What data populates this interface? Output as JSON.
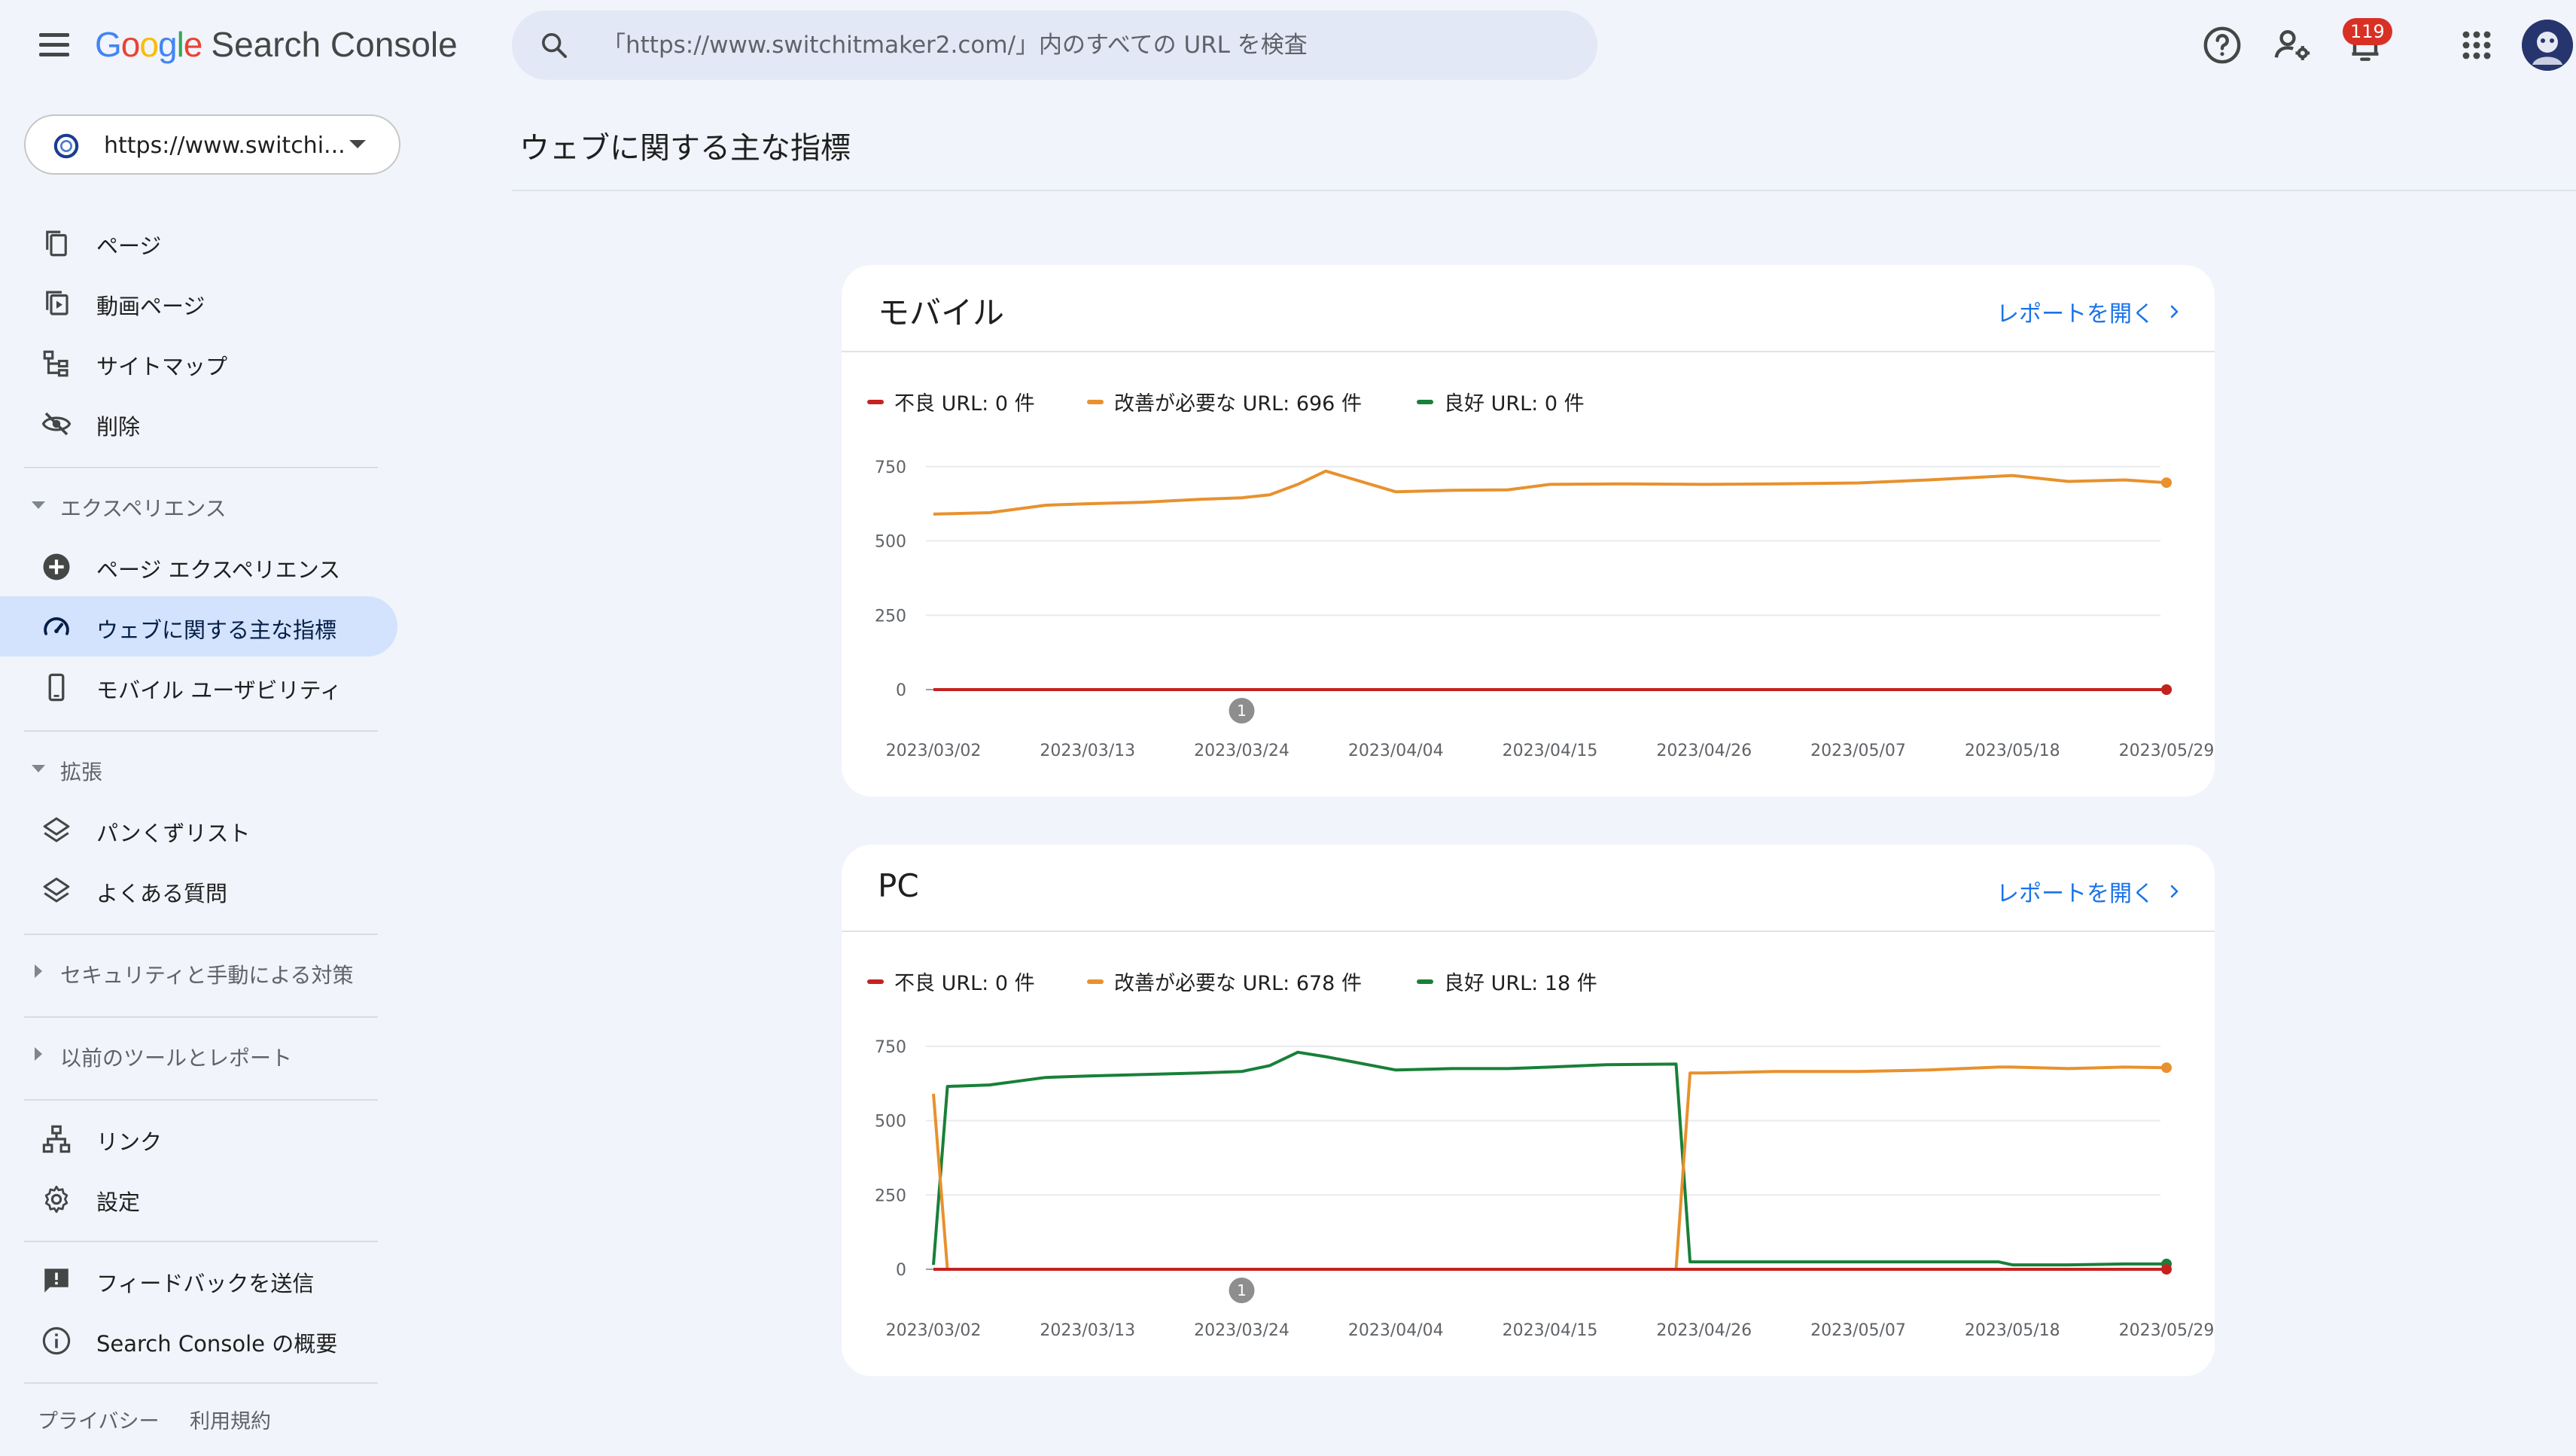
{
  "header": {
    "logo_google": "Google",
    "logo_product": "Search Console",
    "search_placeholder": "「https://www.switchitmaker2.com/」内のすべての URL を検査",
    "notifications_count": "119"
  },
  "sidebar": {
    "property_label": "https://www.switchi...",
    "items_top": [
      {
        "label": "ページ",
        "icon": "pages-icon"
      },
      {
        "label": "動画ページ",
        "icon": "video-pages-icon"
      },
      {
        "label": "サイトマップ",
        "icon": "sitemap-icon"
      },
      {
        "label": "削除",
        "icon": "removals-icon"
      }
    ],
    "section_experience": "エクスペリエンス",
    "items_experience": [
      {
        "label": "ページ エクスペリエンス",
        "icon": "page-experience-icon"
      },
      {
        "label": "ウェブに関する主な指標",
        "icon": "core-web-vitals-icon"
      },
      {
        "label": "モバイル ユーザビリティ",
        "icon": "mobile-icon"
      }
    ],
    "section_enhancements": "拡張",
    "items_enhancements": [
      {
        "label": "パンくずリスト",
        "icon": "layers-icon"
      },
      {
        "label": "よくある質問",
        "icon": "layers-icon"
      }
    ],
    "section_security": "セキュリティと手動による対策",
    "section_legacy": "以前のツールとレポート",
    "items_bottom": [
      {
        "label": "リンク",
        "icon": "links-icon"
      },
      {
        "label": "設定",
        "icon": "settings-icon"
      }
    ],
    "items_footer": [
      {
        "label": "フィードバックを送信",
        "icon": "feedback-icon"
      },
      {
        "label": "Search Console の概要",
        "icon": "info-icon"
      }
    ],
    "footer_links": [
      "プライバシー",
      "利用規約"
    ]
  },
  "main": {
    "page_title": "ウェブに関する主な指標",
    "open_report_label": "レポートを開く"
  },
  "colors": {
    "poor": "#c5221f",
    "needs_improvement": "#e8912d",
    "good": "#188038",
    "annotation": "#8e8e8e"
  },
  "chart_data": [
    {
      "type": "line",
      "title": "モバイル",
      "x": [
        "2023/03/02",
        "2023/03/06",
        "2023/03/10",
        "2023/03/13",
        "2023/03/17",
        "2023/03/21",
        "2023/03/24",
        "2023/03/26",
        "2023/03/28",
        "2023/03/30",
        "2023/04/04",
        "2023/04/08",
        "2023/04/12",
        "2023/04/15",
        "2023/04/20",
        "2023/04/26",
        "2023/05/01",
        "2023/05/07",
        "2023/05/12",
        "2023/05/18",
        "2023/05/22",
        "2023/05/26",
        "2023/05/29"
      ],
      "xticks": [
        "2023/03/02",
        "2023/03/13",
        "2023/03/24",
        "2023/04/04",
        "2023/04/15",
        "2023/04/26",
        "2023/05/07",
        "2023/05/18",
        "2023/05/29"
      ],
      "yticks": [
        0,
        250,
        500,
        750
      ],
      "ylim": [
        0,
        800
      ],
      "series": [
        {
          "name": "不良 URL",
          "legend": "不良 URL: 0 件",
          "color": "#c5221f",
          "values": [
            0,
            0,
            0,
            0,
            0,
            0,
            0,
            0,
            0,
            0,
            0,
            0,
            0,
            0,
            0,
            0,
            0,
            0,
            0,
            0,
            0,
            0,
            0
          ]
        },
        {
          "name": "改善が必要な URL",
          "legend": "改善が必要な URL: 696 件",
          "color": "#e8912d",
          "values": [
            590,
            595,
            620,
            625,
            630,
            640,
            645,
            655,
            690,
            735,
            665,
            670,
            672,
            690,
            692,
            690,
            692,
            695,
            705,
            720,
            700,
            705,
            696
          ]
        },
        {
          "name": "良好 URL",
          "legend": "良好 URL: 0 件",
          "color": "#188038",
          "values": [
            0,
            0,
            0,
            0,
            0,
            0,
            0,
            0,
            0,
            0,
            0,
            0,
            0,
            0,
            0,
            0,
            0,
            0,
            0,
            0,
            0,
            0,
            0
          ]
        }
      ],
      "annotation": {
        "x": "2023/03/24",
        "label": "1"
      }
    },
    {
      "type": "line",
      "title": "PC",
      "x": [
        "2023/03/02",
        "2023/03/03",
        "2023/03/06",
        "2023/03/10",
        "2023/03/13",
        "2023/03/17",
        "2023/03/21",
        "2023/03/24",
        "2023/03/26",
        "2023/03/28",
        "2023/03/30",
        "2023/04/04",
        "2023/04/08",
        "2023/04/12",
        "2023/04/15",
        "2023/04/19",
        "2023/04/24",
        "2023/04/25",
        "2023/04/26",
        "2023/05/01",
        "2023/05/07",
        "2023/05/12",
        "2023/05/17",
        "2023/05/18",
        "2023/05/22",
        "2023/05/26",
        "2023/05/29"
      ],
      "xticks": [
        "2023/03/02",
        "2023/03/13",
        "2023/03/24",
        "2023/04/04",
        "2023/04/15",
        "2023/04/26",
        "2023/05/07",
        "2023/05/18",
        "2023/05/29"
      ],
      "yticks": [
        0,
        250,
        500,
        750
      ],
      "ylim": [
        0,
        800
      ],
      "series": [
        {
          "name": "不良 URL",
          "legend": "不良 URL: 0 件",
          "color": "#c5221f",
          "values": [
            0,
            0,
            0,
            0,
            0,
            0,
            0,
            0,
            0,
            0,
            0,
            0,
            0,
            0,
            0,
            0,
            0,
            0,
            0,
            0,
            0,
            0,
            0,
            0,
            0,
            0,
            0
          ]
        },
        {
          "name": "改善が必要な URL",
          "legend": "改善が必要な URL: 678 件",
          "color": "#e8912d",
          "values": [
            590,
            0,
            0,
            0,
            0,
            0,
            0,
            0,
            0,
            0,
            0,
            0,
            0,
            0,
            0,
            0,
            0,
            660,
            660,
            665,
            665,
            670,
            680,
            680,
            675,
            680,
            678
          ]
        },
        {
          "name": "良好 URL",
          "legend": "良好 URL: 18 件",
          "color": "#188038",
          "values": [
            15,
            615,
            620,
            645,
            650,
            655,
            660,
            665,
            685,
            730,
            715,
            670,
            675,
            675,
            680,
            688,
            690,
            25,
            25,
            25,
            25,
            25,
            25,
            15,
            15,
            18,
            18
          ]
        }
      ],
      "annotation": {
        "x": "2023/03/24",
        "label": "1"
      }
    }
  ]
}
